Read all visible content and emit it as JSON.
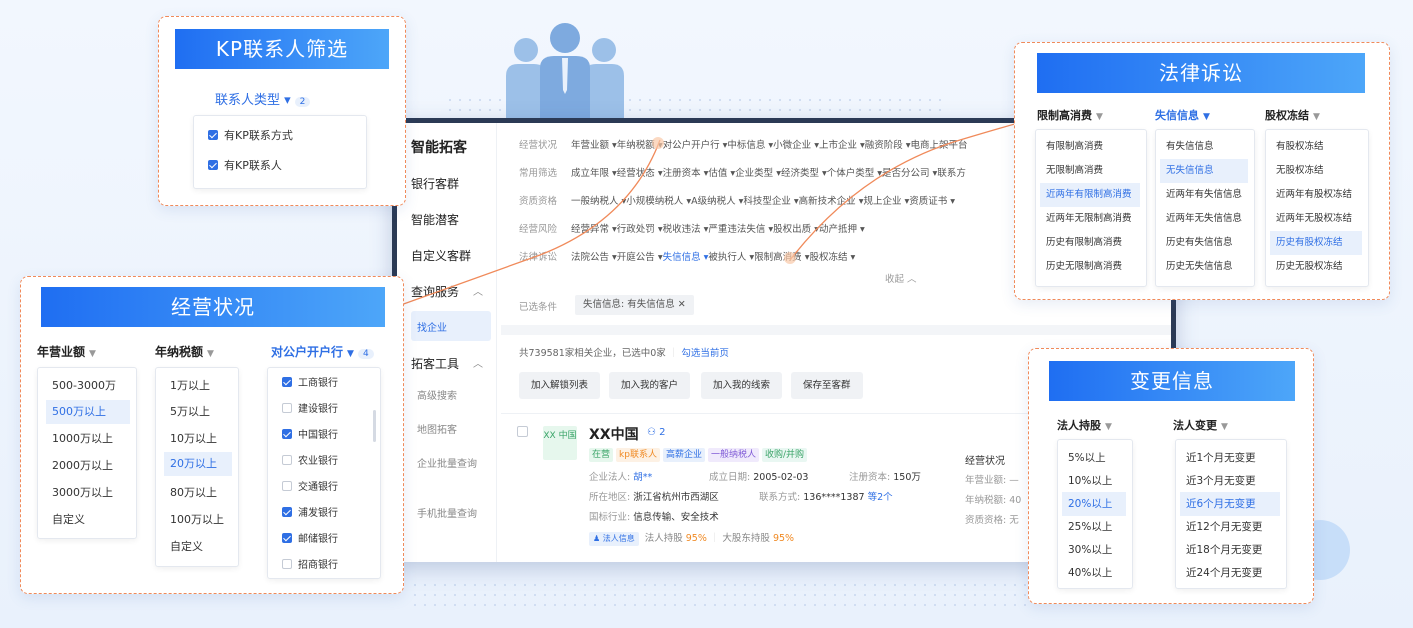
{
  "sidebar": {
    "title": "智能拓客",
    "items": [
      "银行客群",
      "智能潜客",
      "自定义客群",
      "查询服务",
      "找企业",
      "拓客工具"
    ],
    "subitems": [
      "高级搜索",
      "地图拓客",
      "企业批量查询",
      "手机批量查询"
    ]
  },
  "filters": {
    "rows": [
      {
        "label": "经营状况",
        "values": "年营业额 ▾年纳税额 ▾对公户开户行 ▾中标信息 ▾小微企业 ▾上市企业 ▾融资阶段 ▾电商上架平台"
      },
      {
        "label": "常用筛选",
        "values": "成立年限 ▾经营状态 ▾注册资本 ▾估值 ▾企业类型 ▾经济类型 ▾个体户类型 ▾是否分公司 ▾联系方"
      },
      {
        "label": "资质资格",
        "values": "一般纳税人 ▾小规模纳税人 ▾A级纳税人 ▾科技型企业 ▾高新技术企业 ▾规上企业 ▾资质证书 ▾"
      },
      {
        "label": "经营风险",
        "values": "经营异常 ▾行政处罚 ▾税收违法 ▾严重违法失信 ▾股权出质 ▾动产抵押 ▾"
      }
    ],
    "legal_row": {
      "label": "法律诉讼",
      "before": "法院公告 ▾开庭公告 ▾",
      "active": "失信信息 ▾",
      "after": "被执行人 ▾限制高消费 ▾股权冻结 ▾"
    },
    "collapse": "收起 ︿",
    "selected_label": "已选条件",
    "selected_chip": "失信信息: 有失信信息  ✕"
  },
  "results": {
    "count_text": "共739581家相关企业，已选中0家",
    "select_page": "勾选当前页",
    "buttons": [
      "加入解锁列表",
      "加入我的客户",
      "加入我的线索",
      "保存至客群"
    ],
    "company": {
      "logo": "XX 中国",
      "name": "XX中国",
      "count": "⚇ 2",
      "tags": [
        "在营",
        "kp联系人",
        "高薪企业",
        "一般纳税人",
        "收购/并购"
      ],
      "legal_label": "企业法人: ",
      "legal_value": "胡**",
      "founded_label": "成立日期: ",
      "founded_value": "2005-02-03",
      "capital_label": "注册资本: ",
      "capital_value": "150万",
      "region_label": "所在地区: ",
      "region_value": "浙江省杭州市西湖区",
      "contact_label": "联系方式: ",
      "contact_value": "136****1387",
      "contact_more": "等2个",
      "industry_label": "国标行业: ",
      "industry_value": "信息传输、安全技术",
      "badge": "♟ 法人信息",
      "holding1_label": "法人持股 ",
      "holding1_value": "95%",
      "holding2_label": "大股东持股 ",
      "holding2_value": "95%",
      "right_title": "经营状况",
      "right_l1": "年营业额: —",
      "right_l2": "年纳税额: 40",
      "right_l3": "资质资格: 无"
    }
  },
  "kp": {
    "title": "KP联系人筛选",
    "header": "联系人类型 ▾",
    "count": "2",
    "options": [
      "有KP联系方式",
      "有KP联系人"
    ]
  },
  "biz": {
    "title": "经营状况",
    "col1": {
      "header": "年营业额",
      "items": [
        "500-3000万",
        "500万以上",
        "1000万以上",
        "2000万以上",
        "3000万以上",
        "自定义"
      ]
    },
    "col2": {
      "header": "年纳税额",
      "items": [
        "1万以上",
        "5万以上",
        "10万以上",
        "20万以上",
        "80万以上",
        "100万以上",
        "自定义"
      ]
    },
    "col3": {
      "header": "对公户开户行",
      "count": "4",
      "items": [
        "工商银行",
        "建设银行",
        "中国银行",
        "农业银行",
        "交通银行",
        "浦发银行",
        "邮储银行",
        "招商银行"
      ]
    }
  },
  "legal": {
    "title": "法律诉讼",
    "col1": {
      "header": "限制高消费",
      "items": [
        "有限制高消费",
        "无限制高消费",
        "近两年有限制高消费",
        "近两年无限制高消费",
        "历史有限制高消费",
        "历史无限制高消费"
      ]
    },
    "col2": {
      "header": "失信信息",
      "items": [
        "有失信信息",
        "无失信信息",
        "近两年有失信信息",
        "近两年无失信信息",
        "历史有失信信息",
        "历史无失信信息"
      ]
    },
    "col3": {
      "header": "股权冻结",
      "items": [
        "有股权冻结",
        "无股权冻结",
        "近两年有股权冻结",
        "近两年无股权冻结",
        "历史有股权冻结",
        "历史无股权冻结"
      ]
    }
  },
  "change": {
    "title": "变更信息",
    "col1": {
      "header": "法人持股",
      "items": [
        "5%以上",
        "10%以上",
        "20%以上",
        "25%以上",
        "30%以上",
        "40%以上"
      ]
    },
    "col2": {
      "header": "法人变更",
      "items": [
        "近1个月无变更",
        "近3个月无变更",
        "近6个月无变更",
        "近12个月无变更",
        "近18个月无变更",
        "近24个月无变更"
      ]
    }
  },
  "colors": {
    "accent": "#2f6fe4",
    "orange": "#f08a5a",
    "frame": "#2b3a55"
  }
}
